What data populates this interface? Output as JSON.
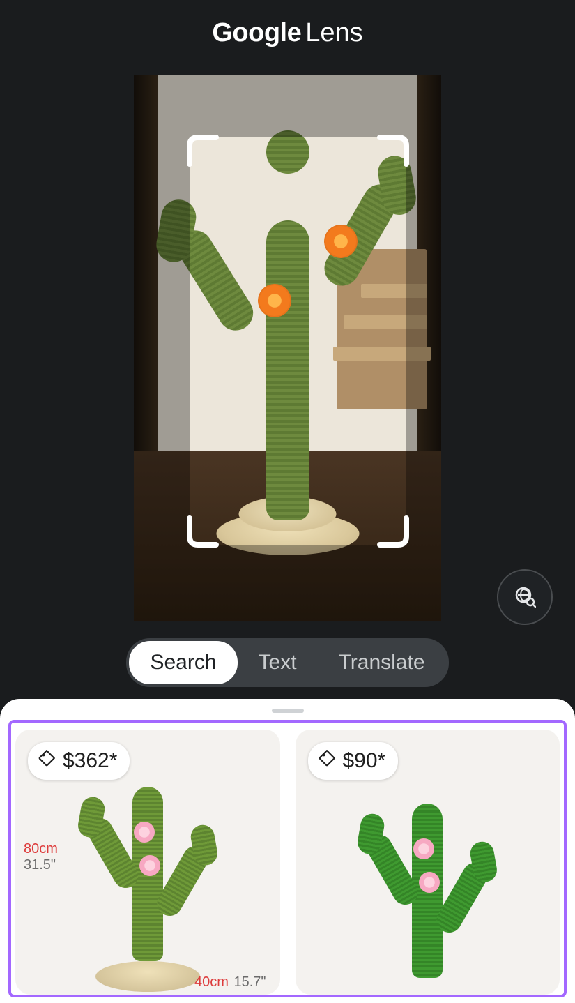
{
  "header": {
    "brand": "Google",
    "product": "Lens"
  },
  "modes": {
    "search": "Search",
    "text": "Text",
    "translate": "Translate",
    "active": "search"
  },
  "icons": {
    "lens_search": "image-search-icon",
    "price_tag": "price-tag-icon"
  },
  "results": [
    {
      "price": "$362*",
      "dimensions": {
        "height_cm": "80cm",
        "height_in": "31.5\"",
        "base_cm": "40cm",
        "base_in": "15.7\""
      }
    },
    {
      "price": "$90*"
    }
  ],
  "colors": {
    "highlight_border": "#a368ff"
  }
}
